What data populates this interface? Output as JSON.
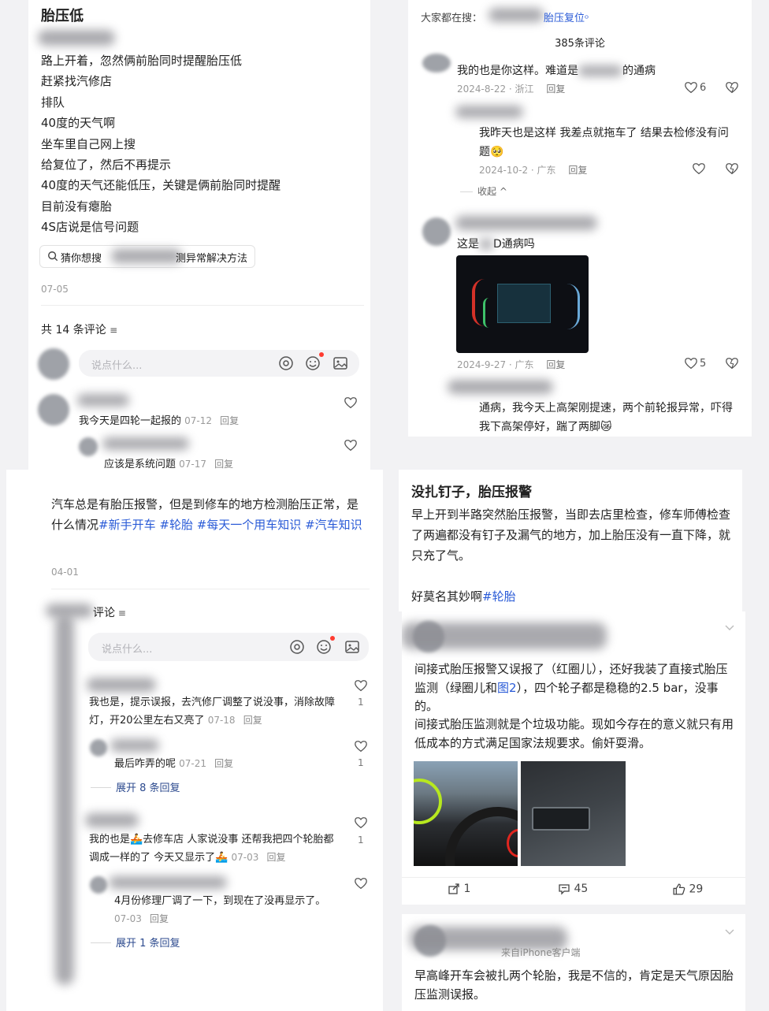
{
  "p1": {
    "title": "胎压低",
    "lines": [
      "路上开着，忽然俩前胎同时提醒胎压低",
      "赶紧找汽修店",
      "排队",
      "40度的天气啊",
      "坐车里自己网上搜",
      "给复位了，然后不再提示",
      "40度的天气还能低压，关键是俩前胎同时提醒",
      "目前没有瘪胎",
      "4S店说是信号问题"
    ],
    "search_prefix": "猜你想搜",
    "search_suffix": "测异常解决方法",
    "date": "07-05",
    "comment_count": "共 14 条评论",
    "input_placeholder": "说点什么...",
    "comments": [
      {
        "text": "我今天是四轮一起报的",
        "date": "07-12",
        "reply": "回复"
      },
      {
        "text": "应该是系统问题",
        "date": "07-17",
        "reply": "回复"
      }
    ]
  },
  "p2": {
    "search_label": "大家都在搜：",
    "search_suffix": "胎压复位",
    "comment_count": "385条评论",
    "c1": {
      "text": "我的也是你这样。难道是",
      "text2": "的通病",
      "date": "2024-8-22 · 浙江",
      "reply": "回复",
      "likes": "6"
    },
    "c2": {
      "text": "我昨天也是这样 我差点就拖车了 结果去检修没有问题🥺",
      "date": "2024-10-2 · 广东",
      "reply": "回复"
    },
    "collapse": "收起 ^",
    "c3": {
      "text": "这是",
      "text2": "D通病吗",
      "date": "2024-9-27 · 广东",
      "reply": "回复",
      "likes": "5"
    },
    "c4": {
      "text": "通病，我今天上高架刚提速，两个前轮报异常，吓得我下高架停好，踹了两脚😿"
    }
  },
  "p3": {
    "text_a": "汽车总是有胎压报警，但是到修车的地方检测胎压正常，是什么情况",
    "tags": [
      "#新手开车",
      "#轮胎",
      "#每天一个用车知识",
      "#汽车知识"
    ],
    "date": "04-01",
    "comment_count_suffix": "评论",
    "input_placeholder": "说点什么...",
    "comments": [
      {
        "text": "我也是，提示误报，去汽修厂调整了说没事，消除故障灯，开20公里左右又亮了",
        "date": "07-18",
        "reply": "回复",
        "likes": "1"
      },
      {
        "text": "最后咋弄的呢",
        "date": "07-21",
        "reply": "回复",
        "likes": "1"
      },
      {
        "text": "我的也是🚣去修车店 人家说没事 还帮我把四个轮胎都调成一样的了 今天又显示了🚣",
        "date": "07-03",
        "reply": "回复",
        "likes": "1"
      },
      {
        "text": "4月份修理厂调了一下，到现在了没再显示了。",
        "date": "07-03",
        "reply": "回复"
      }
    ],
    "expand1": "展开 8 条回复",
    "expand2": "展开 1 条回复"
  },
  "p4": {
    "title": "没扎钉子，胎压报警",
    "body": "早上开到半路突然胎压报警，当即去店里检查，修车师傅检查了两遍都没有钉子及漏气的地方，加上胎压没有一直下降，就只充了气。",
    "body2": "好莫名其妙啊",
    "tag": "#轮胎"
  },
  "p5": {
    "text1": "间接式胎压报警又误报了（红圈儿），还好我装了直接式胎压监测（绿圈儿和",
    "link": "图2",
    "text1b": "），四个轮子都是稳稳的2.5 bar，没事的。",
    "text2": "间接式胎压监测就是个垃圾功能。现如今存在的意义就只有用低成本的方式满足国家法规要求。偷奸耍滑。",
    "share_count": "1",
    "comment_count": "45",
    "like_count": "29"
  },
  "p6": {
    "source": "来自iPhone客户端",
    "text": "早高峰开车会被扎两个轮胎，我是不信的，肯定是天气原因胎压监测误报。"
  },
  "colors": {
    "accent": "#2a5bd7",
    "expand": "#2c4a8e",
    "badge": "#ff3b30"
  }
}
